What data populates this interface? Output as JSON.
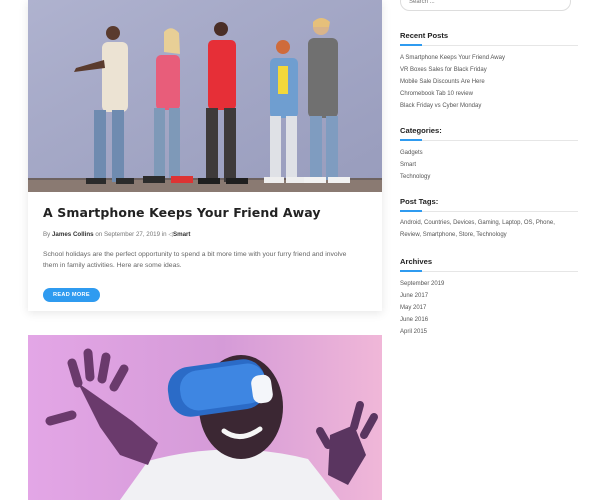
{
  "post1": {
    "title": "A Smartphone Keeps Your Friend Away",
    "meta": {
      "by": "By",
      "author": "James Collins",
      "on": "on",
      "date": "September 27, 2019",
      "in": "in",
      "category": "Smart"
    },
    "excerpt": "School holidays are the perfect opportunity to spend a bit more time with your furry friend and involve them in family activities. Here are some ideas.",
    "read_more": "READ MORE"
  },
  "sidebar": {
    "search_placeholder": "Search ...",
    "recent_posts": {
      "title": "Recent Posts",
      "items": [
        "A Smartphone Keeps Your Friend Away",
        "VR Boxes Sales for Black Friday",
        "Mobile Sale Discounts Are Here",
        "Chromebook Tab 10 review",
        "Black Friday vs Cyber Monday"
      ]
    },
    "categories": {
      "title": "Categories:",
      "items": [
        "Gadgets",
        "Smart",
        "Technology"
      ]
    },
    "tags": {
      "title": "Post Tags:",
      "items": [
        "Android",
        "Countries",
        "Devices",
        "Gaming",
        "Laptop",
        "OS",
        "Phone",
        "Review",
        "Smartphone",
        "Store",
        "Technology"
      ]
    },
    "archives": {
      "title": "Archives",
      "items": [
        "September 2019",
        "June 2017",
        "May 2017",
        "June 2016",
        "April 2015"
      ]
    }
  },
  "colors": {
    "accent": "#2f9bf0",
    "photo1_wall": "#a5a9c7",
    "photo2_background": "#dca0dc"
  },
  "icons": {
    "tag": "tag-icon"
  }
}
